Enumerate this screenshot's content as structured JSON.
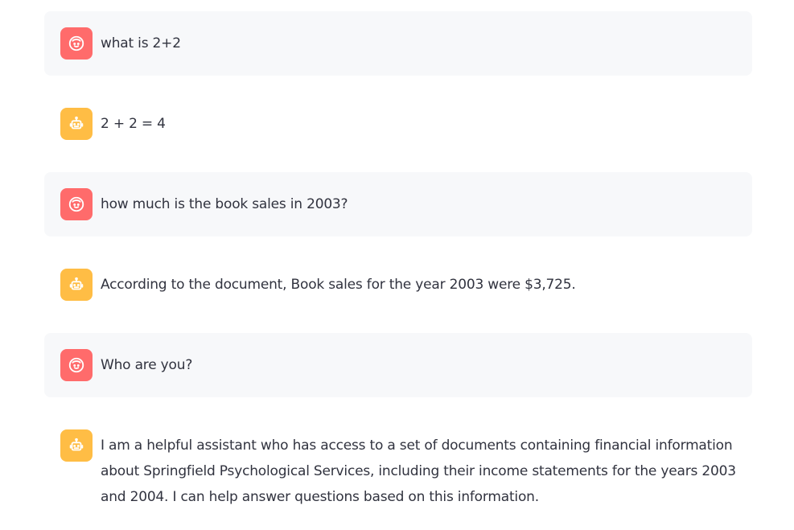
{
  "messages": [
    {
      "role": "user",
      "avatar_icon": "smiling-face-icon",
      "text": "what is 2+2"
    },
    {
      "role": "assistant",
      "avatar_icon": "robot-icon",
      "text": "2 + 2 = 4"
    },
    {
      "role": "user",
      "avatar_icon": "smiling-face-icon",
      "text": "how much is the book sales in 2003?"
    },
    {
      "role": "assistant",
      "avatar_icon": "robot-icon",
      "text": "According to the document, Book sales for the year 2003 were $3,725."
    },
    {
      "role": "user",
      "avatar_icon": "smiling-face-icon",
      "text": "Who are you?"
    },
    {
      "role": "assistant",
      "avatar_icon": "robot-icon",
      "text": "I am a helpful assistant who has access to a set of documents containing financial information about Springfield Psychological Services, including their income statements for the years 2003 and 2004. I can help answer questions based on this information."
    }
  ],
  "colors": {
    "user_avatar": "#ff6b6b",
    "assistant_avatar": "#ffbd45",
    "user_bubble": "#f7f8fa",
    "text": "#31333f"
  }
}
